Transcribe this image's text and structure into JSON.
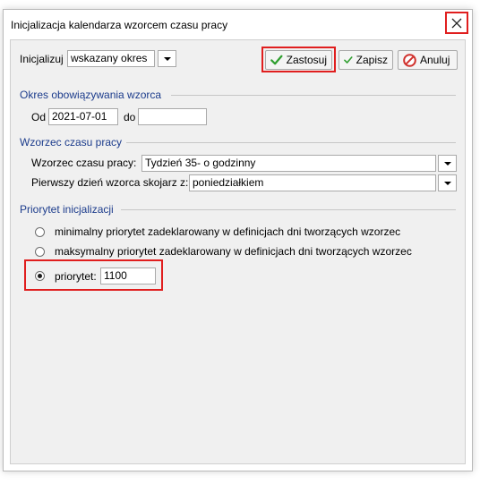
{
  "window": {
    "title": "Inicjalizacja kalendarza wzorcem czasu pracy",
    "close_icon": "close-icon"
  },
  "toolbar": {
    "init_label": "Inicjalizuj",
    "init_value": "wskazany okres",
    "apply_label": "Zastosuj",
    "save_label": "Zapisz",
    "cancel_label": "Anuluj"
  },
  "period": {
    "group_title": "Okres obowiązywania wzorca",
    "from_label": "Od",
    "from_value": "2021-07-01",
    "to_label": "do",
    "to_value": ""
  },
  "pattern": {
    "group_title": "Wzorzec czasu pracy",
    "pattern_label": "Wzorzec czasu pracy:",
    "pattern_value": "Tydzień 35- o godzinny",
    "first_day_label": "Pierwszy dzień wzorca skojarz z:",
    "first_day_value": "poniedziałkiem"
  },
  "priority": {
    "group_title": "Priorytet inicjalizacji",
    "option_min": "minimalny priorytet zadeklarowany w definicjach dni tworzących wzorzec",
    "option_max": "maksymalny priorytet zadeklarowany w definicjach dni tworzących wzorzec",
    "option_custom": "priorytet:",
    "custom_value": "1100",
    "selected": "priorytet"
  },
  "colors": {
    "highlight": "#e01e1e",
    "group_title": "#1c3c8c",
    "check_green": "#2e9e2e",
    "cancel_red": "#d0312d"
  }
}
